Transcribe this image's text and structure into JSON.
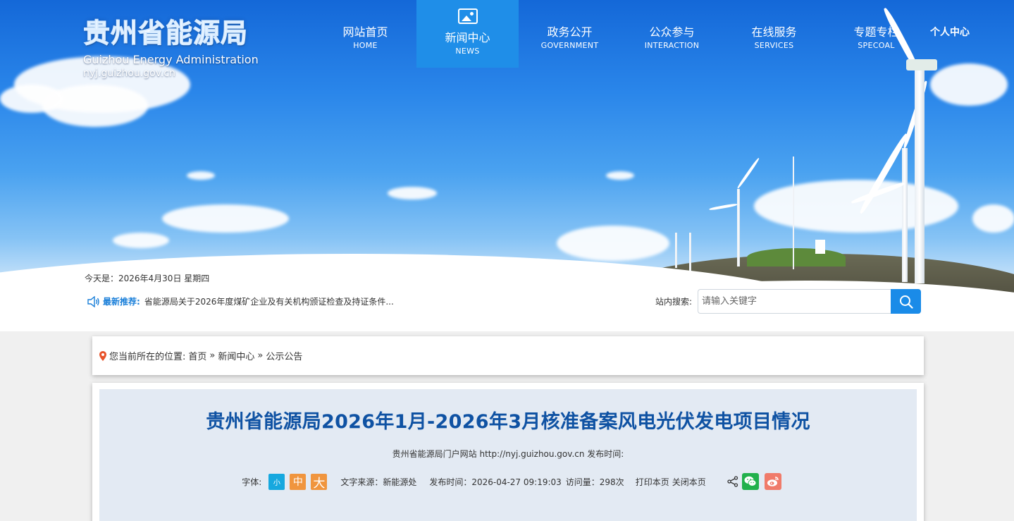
{
  "site": {
    "name_cn": "贵州省能源局",
    "name_en": "Guizhou Energy Administration",
    "url": "nyj.guizhou.gov.cn"
  },
  "nav": {
    "items": [
      {
        "cn": "网站首页",
        "en": "HOME"
      },
      {
        "cn": "新闻中心",
        "en": "NEWS"
      },
      {
        "cn": "政务公开",
        "en": "GOVERNMENT"
      },
      {
        "cn": "公众参与",
        "en": "INTERACTION"
      },
      {
        "cn": "在线服务",
        "en": "SERVICES"
      },
      {
        "cn": "专题专栏",
        "en": "SPECOAL"
      }
    ],
    "user_center": "个人中心"
  },
  "info": {
    "today": "今天是：2026年4月30日 星期四",
    "latest_label": "最新推荐:",
    "latest_text": "省能源局关于2026年度煤矿企业及有关机构颁证检查及持证条件..."
  },
  "search": {
    "label": "站内搜索:",
    "placeholder": "请输入关键字"
  },
  "breadcrumb": {
    "prefix": "您当前所在的位置:",
    "items": [
      "首页",
      "新闻中心",
      "公示公告"
    ],
    "sep": "»"
  },
  "article": {
    "title": "贵州省能源局2026年1月-2026年3月核准备案风电光伏发电项目情况",
    "source_line": "贵州省能源局门户网站 http://nyj.guizhou.gov.cn 发布时间:",
    "font_label": "字体:",
    "font_small": "小",
    "font_medium": "中",
    "font_large": "大",
    "text_source": "文字来源：新能源处",
    "publish_time": "发布时间：2026-04-27 09:19:03",
    "visits": "访问量：298次",
    "print": "打印本页",
    "close": "关闭本页"
  },
  "colors": {
    "accent": "#1a8be8",
    "title": "#0f52a3",
    "nav_active": "#1f8ee8",
    "font_small": "#16a8df",
    "font_medium_large": "#f0953e",
    "wechat": "#22b14c",
    "weibo": "#f07b6a"
  },
  "icons": [
    "speaker-icon",
    "search-icon",
    "location-pin-icon",
    "share-icon",
    "wechat-icon",
    "weibo-icon",
    "picture-icon"
  ]
}
